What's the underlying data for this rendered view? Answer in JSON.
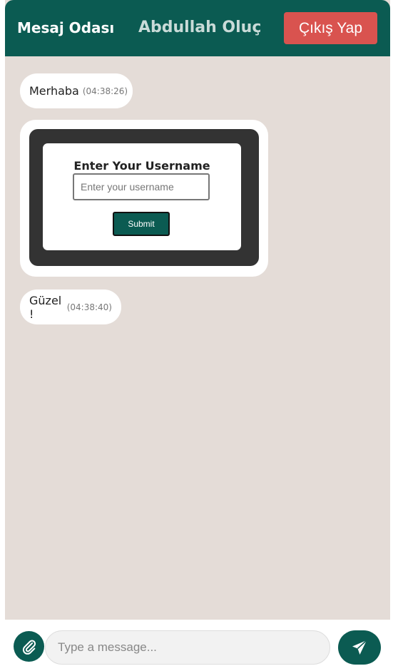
{
  "header": {
    "room_title": "Mesaj Odası",
    "user_name": "Abdullah Oluç",
    "logout_label": "Çıkış Yap"
  },
  "messages": [
    {
      "text": "Merhaba",
      "time": "(04:38:26)"
    },
    {
      "type": "embedded-form",
      "form_title": "Enter Your Username",
      "input_placeholder": "Enter your username",
      "submit_label": "Submit"
    },
    {
      "text": "Güzel !",
      "time": "(04:38:40)"
    }
  ],
  "composer": {
    "placeholder": "Type a message...",
    "attach_icon": "paperclip-icon",
    "send_icon": "paper-plane-icon"
  },
  "colors": {
    "header": "#0b5b52",
    "chat_bg": "#e4dcd7",
    "logout": "#d9534f",
    "bubble": "#ffffff"
  }
}
